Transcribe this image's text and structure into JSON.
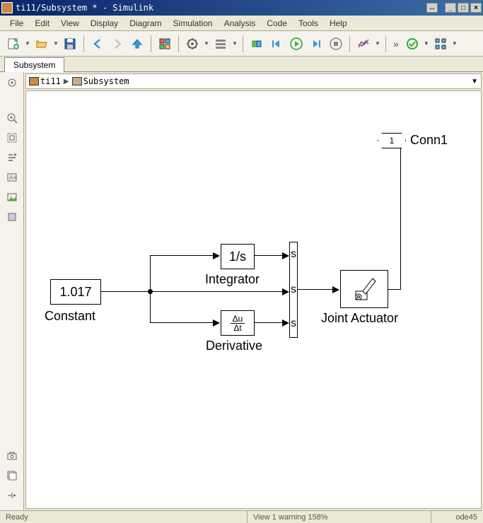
{
  "window": {
    "title": "ti11/Subsystem * - Simulink"
  },
  "menu": [
    "File",
    "Edit",
    "View",
    "Display",
    "Diagram",
    "Simulation",
    "Analysis",
    "Code",
    "Tools",
    "Help"
  ],
  "tabs": [
    "Subsystem"
  ],
  "breadcrumb": {
    "root": "ti11",
    "child": "Subsystem"
  },
  "diagram": {
    "constant": {
      "value": "1.017",
      "label": "Constant"
    },
    "integrator": {
      "text": "1/s",
      "label": "Integrator"
    },
    "derivative": {
      "label": "Derivative",
      "num": "Δu",
      "den": "Δt"
    },
    "mux_labels": [
      "s",
      "s",
      "s"
    ],
    "joint_actuator": {
      "label": "Joint Actuator"
    },
    "conn1": {
      "num": "1",
      "label": "Conn1"
    }
  },
  "status": {
    "ready": "Ready",
    "view": "View 1 warning 158%",
    "solver": "ode45"
  }
}
